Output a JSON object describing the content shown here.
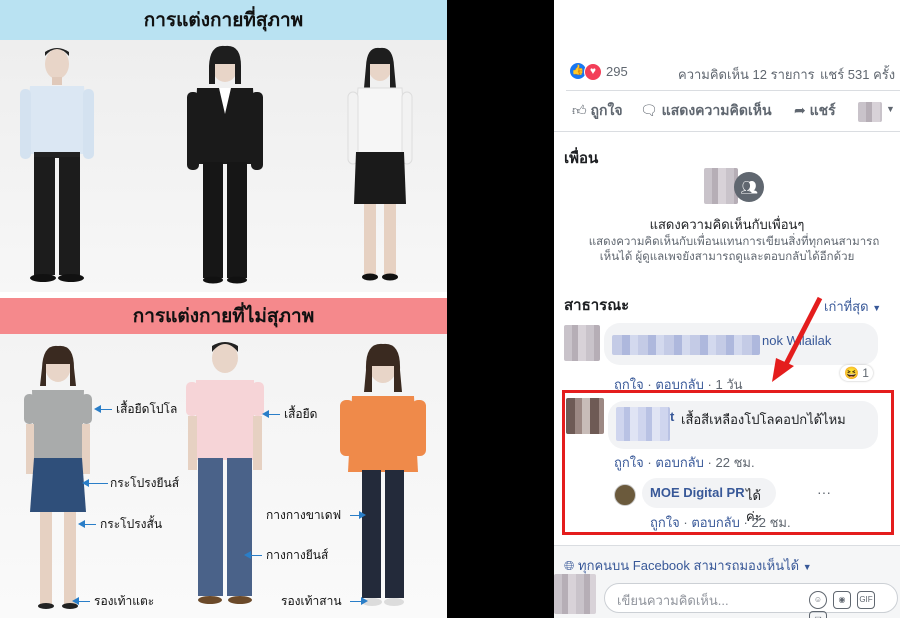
{
  "infographic": {
    "good_title": "การแต่งกายที่สุภาพ",
    "bad_title": "การแต่งกายที่ไม่สุภาพ",
    "labels": {
      "polo_shirt": "เสื้อยืดโปโล",
      "jean_skirt": "กระโปรงยีนส์",
      "short_skirt": "กระโปรงสั้น",
      "flip_flops": "รองเท้าแตะ",
      "tshirt": "เสื้อยืด",
      "leggings": "กางกางขาเดฟ",
      "jeans": "กางกางยีนส์",
      "sneakers": "รองเท้าสาน"
    }
  },
  "facebook": {
    "reactions_count": "295",
    "comments_count": "ความคิดเห็น 12 รายการ",
    "shares_count": "แชร์ 531 ครั้ง",
    "actions": {
      "like": "ถูกใจ",
      "comment": "แสดงความคิดเห็น",
      "share": "แชร์"
    },
    "friends": {
      "heading": "เพื่อน",
      "title": "แสดงความคิดเห็นกับเพื่อนๆ",
      "desc_line1": "แสดงความคิดเห็นกับเพื่อนแทนการเขียนสิ่งที่ทุกคนสามารถ",
      "desc_line2": "เห็นได้ ผู้ดูแลเพจยังสามารถดูและตอบกลับได้อีกด้วย"
    },
    "public": {
      "heading": "สาธารณะ",
      "sort": "เก่าที่สุด"
    },
    "comments": [
      {
        "author_partial": "nok Wilailak",
        "like": "ถูกใจ",
        "reply": "ตอบกลับ",
        "time": "1 วัน",
        "reaction_count": "1"
      },
      {
        "author_partial": "t",
        "text": "เสื้อสีเหลืองโปโลคอปกได้ไหม",
        "like": "ถูกใจ",
        "reply": "ตอบกลับ",
        "time": "22 ชม."
      }
    ],
    "reply": {
      "author": "MOE Digital PR",
      "text": "ได้ค่ะ",
      "like": "ถูกใจ",
      "reply": "ตอบกลับ",
      "time": "22 ชม.",
      "more": "···"
    },
    "audience": "ทุกคนบน Facebook สามารถมองเห็นได้",
    "input_placeholder": "เขียนความคิดเห็น...",
    "separator": "·",
    "colors": {
      "link": "#385898",
      "highlight": "#e41d1d",
      "arrow": "#e41d1d"
    }
  }
}
